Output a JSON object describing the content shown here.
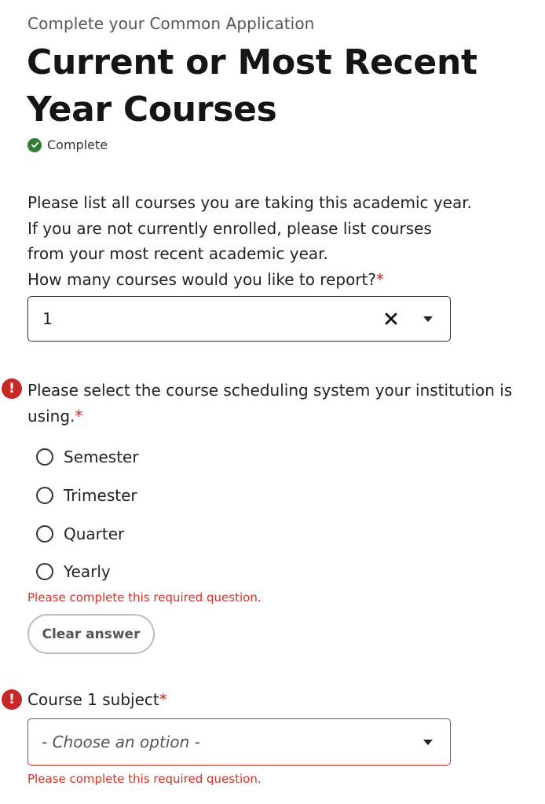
{
  "header": {
    "eyebrow": "Complete your Common Application",
    "title": "Current or Most Recent Year Courses",
    "status": "Complete"
  },
  "intro": {
    "lines": [
      "Please list all courses you are taking this academic year.",
      "If you are not currently enrolled, please list courses",
      "from your most recent academic year."
    ]
  },
  "count_question": {
    "label": "How many courses would you like to report?",
    "required_mark": "*",
    "value": "1"
  },
  "scheduling_question": {
    "label": "Please select the course scheduling system your institution is using.",
    "required_mark": "*",
    "options": [
      "Semester",
      "Trimester",
      "Quarter",
      "Yearly"
    ],
    "error": "Please complete this required question.",
    "clear_label": "Clear answer"
  },
  "subject_question": {
    "label": "Course 1 subject",
    "required_mark": "*",
    "placeholder": "- Choose an option -",
    "error": "Please complete this required question."
  },
  "colors": {
    "error": "#d93025",
    "success": "#2e7d32"
  }
}
